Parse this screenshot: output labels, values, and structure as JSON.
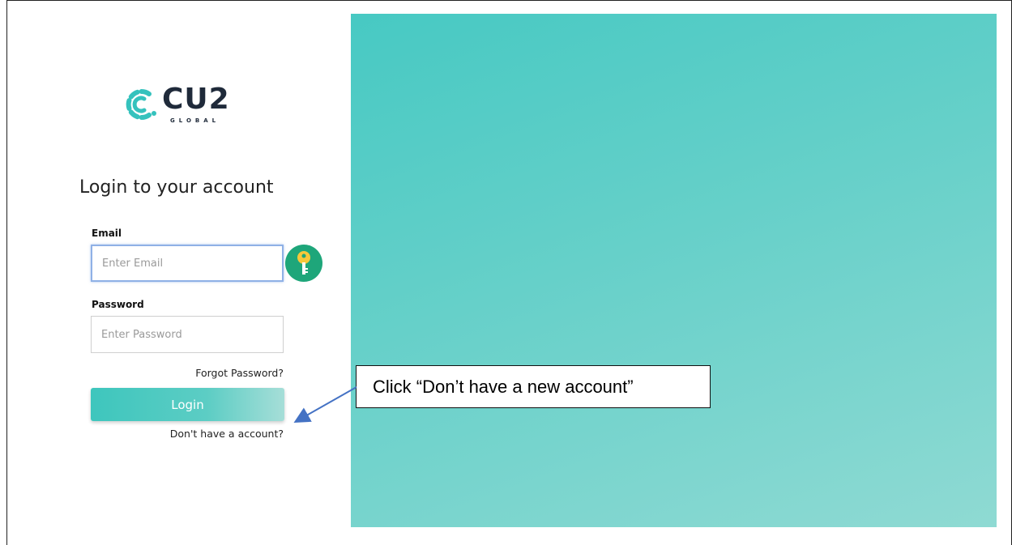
{
  "brand": {
    "name": "CU2",
    "tagline": "GLOBAL",
    "primary_color": "#47c9c3",
    "logo_icon": "cu2-swirl-logo-icon"
  },
  "login": {
    "heading": "Login to your account",
    "email_label": "Email",
    "email_placeholder": "Enter Email",
    "email_value": "",
    "password_label": "Password",
    "password_placeholder": "Enter Password",
    "password_value": "",
    "forgot_link": "Forgot Password?",
    "login_button": "Login",
    "signup_link": "Don't have a account?",
    "password_manager_icon": "key-icon"
  },
  "annotation": {
    "callout_text": "Click “Don’t have a new account”"
  }
}
